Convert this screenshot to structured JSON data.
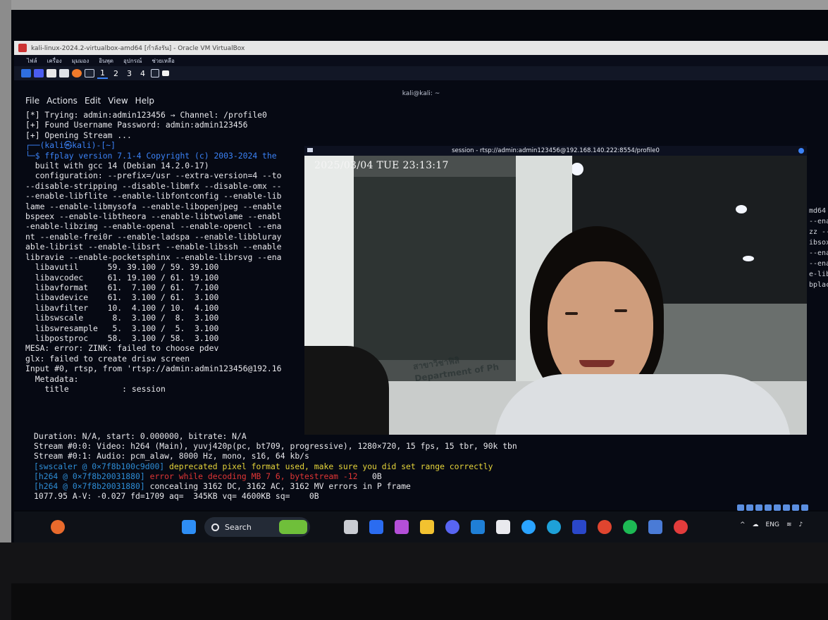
{
  "vbox": {
    "title": "kali-linux-2024.2-virtualbox-amd64 [กำลังรัน] - Oracle VM VirtualBox",
    "menu": [
      "ไฟล์",
      "เครื่อง",
      "มุมมอง",
      "อินพุต",
      "อุปกรณ์",
      "ช่วยเหลือ"
    ]
  },
  "kali_panel": {
    "workspaces": [
      "1",
      "2",
      "3",
      "4"
    ]
  },
  "terminal": {
    "title": "kali@kali: ~",
    "menu": [
      "File",
      "Actions",
      "Edit",
      "View",
      "Help"
    ],
    "lines": [
      "[*] Trying: admin:admin123456 → Channel: /profile0",
      "[+] Found Username Password: admin:admin123456",
      "[+] Opening Stream ...",
      "",
      "┌──(kali㉿kali)-[~]",
      "└─$ ffplay version 7.1-4 Copyright (c) 2003-2024 the",
      "  built with gcc 14 (Debian 14.2.0-17)",
      "  configuration: --prefix=/usr --extra-version=4 --to",
      "--disable-stripping --disable-libmfx --disable-omx --",
      "--enable-libflite --enable-libfontconfig --enable-lib",
      "lame --enable-libmysofa --enable-libopenjpeg --enable",
      "bspeex --enable-libtheora --enable-libtwolame --enabl",
      "-enable-libzimg --enable-openal --enable-opencl --ena",
      "nt --enable-frei0r --enable-ladspa --enable-libbluray",
      "able-librist --enable-libsrt --enable-libssh --enable",
      "libravie --enable-pocketsphinx --enable-librsvg --ena",
      "  libavutil      59. 39.100 / 59. 39.100",
      "  libavcodec     61. 19.100 / 61. 19.100",
      "  libavformat    61.  7.100 / 61.  7.100",
      "  libavdevice    61.  3.100 / 61.  3.100",
      "  libavfilter    10.  4.100 / 10.  4.100",
      "  libswscale      8.  3.100 /  8.  3.100",
      "  libswresample   5.  3.100 /  5.  3.100",
      "  libpostproc    58.  3.100 / 58.  3.100",
      "MESA: error: ZINK: failed to choose pdev",
      "glx: failed to create drisw screen",
      "Input #0, rtsp, from 'rtsp://admin:admin123456@192.16",
      "  Metadata:",
      "    title           : session"
    ],
    "bottom": {
      "l1": "Duration: N/A, start: 0.000000, bitrate: N/A",
      "l2": "Stream #0:0: Video: h264 (Main), yuvj420p(pc, bt709, progressive), 1280×720, 15 fps, 15 tbr, 90k tbn",
      "l3": "Stream #0:1: Audio: pcm_alaw, 8000 Hz, mono, s16, 64 kb/s",
      "l4_tag": "[swscaler @ 0×7f8b100c9d00]",
      "l4_msg": " deprecated pixel format used, make sure you did set range correctly",
      "l5_tag": "[h264 @ 0×7f8b20031880]",
      "l5_msg": " error while decoding MB 7 6, bytestream -12",
      "l5_tail": "   0B",
      "l6_tag": "[h264 @ 0×7f8b20031880]",
      "l6_msg": " concealing 3162 DC, 3162 AC, 3162 MV errors in P frame",
      "l7": "1077.95 A-V: -0.027 fd=1709 aq=  345KB vq= 4600KB sq=    0B"
    },
    "right_fragment": [
      "md64",
      "--ena",
      "zz --",
      "ibsox",
      "--ena",
      "--ena",
      "e-lib",
      "bplace"
    ]
  },
  "ffplay": {
    "title": "session - rtsp://admin:admin123456@192.168.140.222:8554/profile0",
    "osd_time": "2025/03/04 TUE 23:13:17",
    "sign_text_1": "สาขาวิชาฟิสิ",
    "sign_text_2": "Department of Ph"
  },
  "taskbar": {
    "search_label": "Search",
    "language": "ENG"
  },
  "colors": {
    "prompt_blue": "#3b82f6",
    "warning_yellow": "#e5d43a",
    "error_red": "#e03535",
    "tag_cyan": "#2e8dd6"
  }
}
